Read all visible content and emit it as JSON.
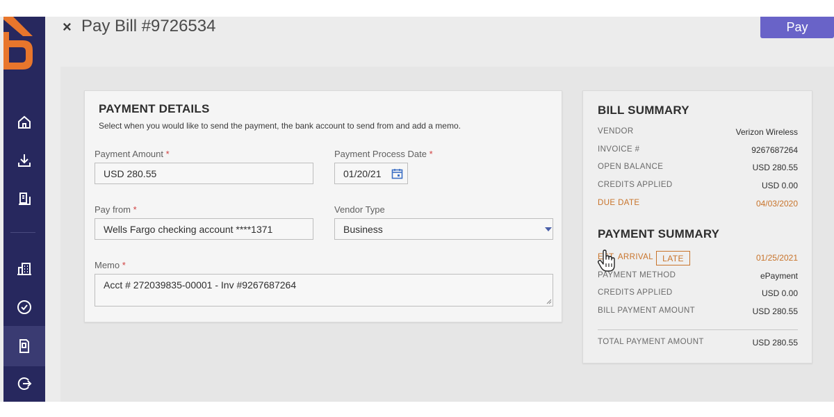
{
  "header": {
    "title": "Pay Bill #9726534",
    "close_glyph": "×",
    "pay_label": "Pay"
  },
  "sidebar": {
    "items": [
      {
        "icon": "home-icon"
      },
      {
        "icon": "download-icon"
      },
      {
        "icon": "document-icon"
      },
      {
        "icon": "building-icon"
      },
      {
        "icon": "check-circle-icon"
      },
      {
        "icon": "bill-icon",
        "active": true
      },
      {
        "icon": "logout-icon"
      }
    ]
  },
  "payment_details": {
    "title": "PAYMENT DETAILS",
    "subtitle": "Select when you would like to send the payment, the bank account to send from and add a memo.",
    "amount_label": "Payment Amount",
    "amount_value": "USD 280.55",
    "date_label": "Payment Process Date",
    "date_value": "01/20/21",
    "payfrom_label": "Pay from",
    "payfrom_value": "Wells Fargo checking account ****1371",
    "vendortype_label": "Vendor Type",
    "vendortype_value": "Business",
    "memo_label": "Memo",
    "memo_value": "Acct # 272039835-00001 - Inv #9267687264",
    "required_mark": "*"
  },
  "bill_summary": {
    "title": "BILL SUMMARY",
    "rows": [
      {
        "label": "VENDOR",
        "value": "Verizon Wireless"
      },
      {
        "label": "INVOICE #",
        "value": "9267687264"
      },
      {
        "label": "OPEN BALANCE",
        "value": "USD 280.55"
      },
      {
        "label": "CREDITS APPLIED",
        "value": "USD 0.00"
      },
      {
        "label": "DUE DATE",
        "value": "04/03/2020"
      }
    ]
  },
  "payment_summary": {
    "title": "PAYMENT SUMMARY",
    "est_arrival_label": "EST. ARRIVAL",
    "late_badge": "LATE",
    "est_arrival_value": "01/25/2021",
    "method_label": "PAYMENT METHOD",
    "method_value": "ePayment",
    "credits_label": "CREDITS APPLIED",
    "credits_value": "USD 0.00",
    "bill_amount_label": "BILL PAYMENT AMOUNT",
    "bill_amount_value": "USD 280.55",
    "total_label": "TOTAL PAYMENT AMOUNT",
    "total_value": "USD 280.55"
  },
  "colors": {
    "sidebar_bg": "#27285e",
    "brand_orange": "#e8762c",
    "pay_button": "#6963c8",
    "warning_orange": "#c8732a"
  }
}
